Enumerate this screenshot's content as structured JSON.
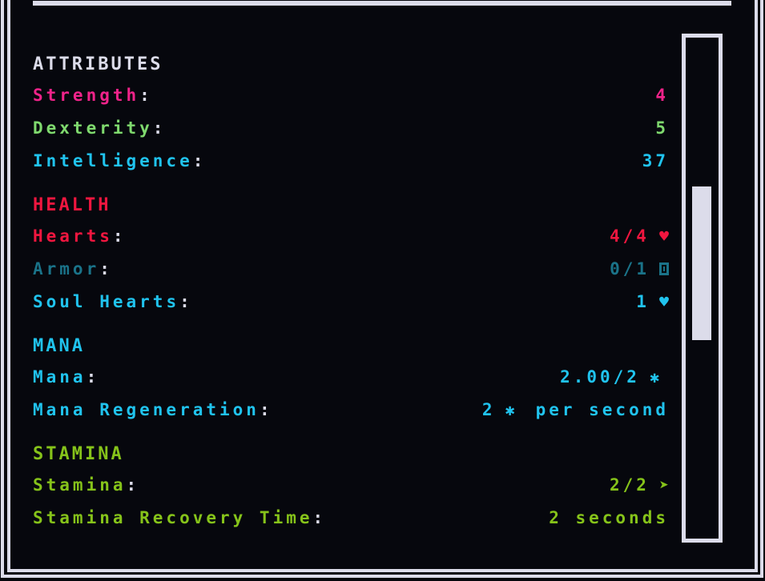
{
  "attributes": {
    "title": "ATTRIBUTES",
    "rows": [
      {
        "label": "Strength",
        "value": "4"
      },
      {
        "label": "Dexterity",
        "value": "5"
      },
      {
        "label": "Intelligence",
        "value": "37"
      }
    ]
  },
  "health": {
    "title": "HEALTH",
    "hearts": {
      "label": "Hearts",
      "value": "4/4",
      "icon": "heart-icon",
      "glyph": "♥"
    },
    "armor": {
      "label": "Armor",
      "value": "0/1",
      "icon": "shield-icon"
    },
    "soul_hearts": {
      "label_a": "Soul",
      "label_b": "Hearts",
      "value": "1",
      "icon": "soul-heart-icon",
      "glyph": "♥"
    }
  },
  "mana": {
    "title": "MANA",
    "mana": {
      "label": "Mana",
      "value": "2.00/2",
      "icon": "star-icon",
      "glyph": "✱"
    },
    "regen": {
      "label": "Mana Regeneration",
      "value": "2",
      "icon": "star-icon",
      "glyph": "✱",
      "suffix": "per second"
    }
  },
  "stamina": {
    "title": "STAMINA",
    "stamina": {
      "label": "Stamina",
      "value": "2/2",
      "icon": "arrow-icon",
      "glyph": "➤"
    },
    "recovery": {
      "label": "Stamina Recovery Time",
      "value": "2 seconds"
    }
  },
  "colon": ":",
  "scroll": {
    "position_fraction": 0.3
  }
}
